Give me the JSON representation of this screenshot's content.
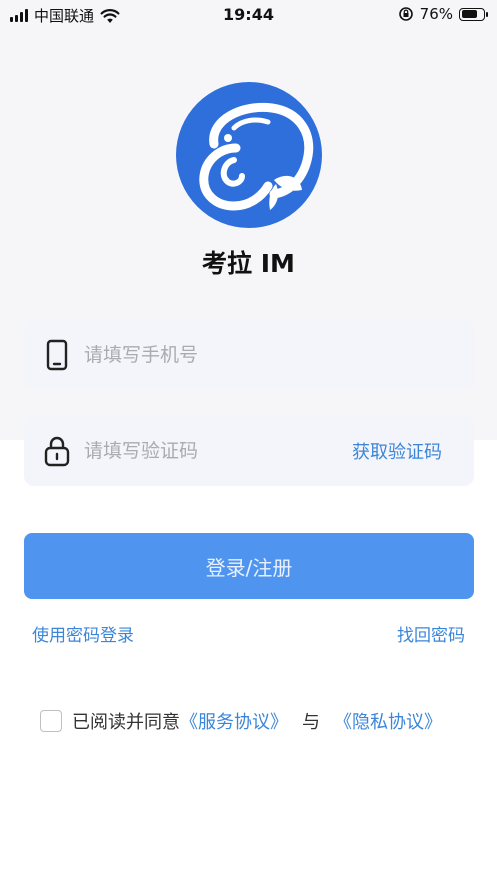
{
  "status_bar": {
    "carrier": "中国联通",
    "time": "19:44",
    "battery": "76%",
    "battery_level": 0.76
  },
  "app": {
    "name": "考拉 IM",
    "logo_color": "#2f6fdc"
  },
  "form": {
    "phone_placeholder": "请填写手机号",
    "code_placeholder": "请填写验证码",
    "get_code_label": "获取验证码",
    "submit_label": "登录/注册",
    "password_login_label": "使用密码登录",
    "recover_password_label": "找回密码"
  },
  "agreement": {
    "prefix": "已阅读并同意",
    "service_link": "《服务协议》",
    "conjunction": "与",
    "privacy_link": "《隐私协议》",
    "checked": false
  },
  "colors": {
    "accent": "#4f95ef",
    "link": "#3b86d8"
  },
  "icons": {
    "phone": "phone-icon",
    "lock": "lock-icon",
    "wifi": "wifi-icon",
    "signal": "signal-icon",
    "battery": "battery-icon",
    "orientation_lock": "orientation-lock-icon"
  }
}
